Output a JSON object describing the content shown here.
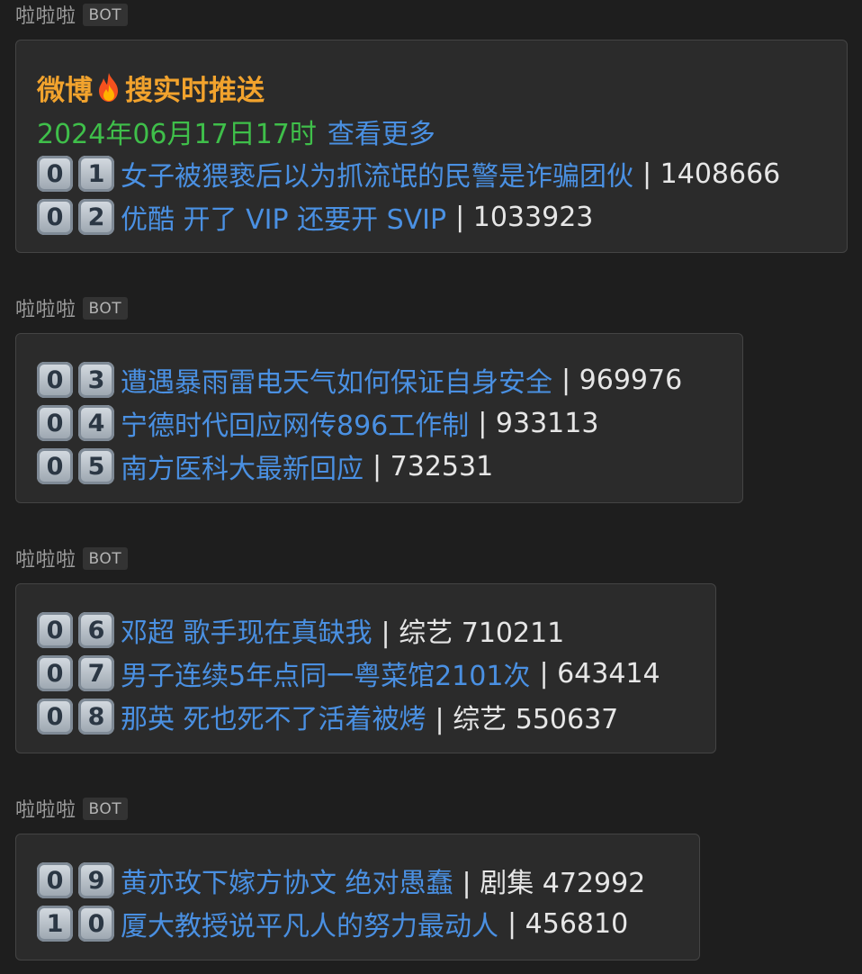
{
  "sender": {
    "name": "啦啦啦",
    "badge": "BOT"
  },
  "colors": {
    "title": "#f2a32d",
    "date": "#3fbf4a",
    "link": "#4a90e2",
    "text": "#e6e6e6",
    "background": "#1e1e1e",
    "bubble": "#2b2b2b"
  },
  "messages": [
    {
      "title_left": "微博",
      "title_icon": "fire-icon",
      "title_right": "搜实时推送",
      "date": "2024年06月17日17时",
      "more": "查看更多",
      "items": [
        {
          "d1": "0",
          "d2": "1",
          "text": "女子被猥亵后以为抓流氓的民警是诈骗团伙",
          "meta": "| 1408666"
        },
        {
          "d1": "0",
          "d2": "2",
          "text": "优酷 开了 VIP 还要开 SVIP",
          "meta": "| 1033923"
        }
      ]
    },
    {
      "items": [
        {
          "d1": "0",
          "d2": "3",
          "text": "遭遇暴雨雷电天气如何保证自身安全",
          "meta": "| 969976"
        },
        {
          "d1": "0",
          "d2": "4",
          "text": "宁德时代回应网传896工作制",
          "meta": "| 933113"
        },
        {
          "d1": "0",
          "d2": "5",
          "text": "南方医科大最新回应",
          "meta": "| 732531"
        }
      ]
    },
    {
      "items": [
        {
          "d1": "0",
          "d2": "6",
          "text": "邓超 歌手现在真缺我",
          "meta": "| 综艺 710211"
        },
        {
          "d1": "0",
          "d2": "7",
          "text": "男子连续5年点同一粤菜馆2101次",
          "meta": "| 643414"
        },
        {
          "d1": "0",
          "d2": "8",
          "text": "那英 死也死不了活着被烤",
          "meta": "| 综艺 550637"
        }
      ]
    },
    {
      "items": [
        {
          "d1": "0",
          "d2": "9",
          "text": "黄亦玫下嫁方协文 绝对愚蠢",
          "meta": "| 剧集 472992"
        },
        {
          "d1": "1",
          "d2": "0",
          "text": "厦大教授说平凡人的努力最动人",
          "meta": "| 456810"
        }
      ]
    }
  ]
}
